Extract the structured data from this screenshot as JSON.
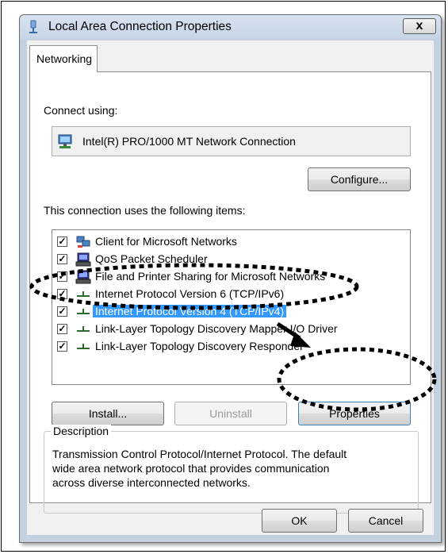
{
  "window": {
    "title": "Local Area Connection Properties",
    "close_label": "x"
  },
  "tabs": [
    {
      "label": "Networking"
    }
  ],
  "connect_using": {
    "label": "Connect using:",
    "adapter": "Intel(R) PRO/1000 MT Network Connection",
    "configure_label": "Configure..."
  },
  "items_section": {
    "label": "This connection uses the following items:",
    "items": [
      {
        "label": "Client for Microsoft Networks",
        "checked": true,
        "icon": "network-client-icon"
      },
      {
        "label": "QoS Packet Scheduler",
        "checked": true,
        "icon": "service-icon"
      },
      {
        "label": "File and Printer Sharing for Microsoft Networks",
        "checked": true,
        "icon": "service-icon"
      },
      {
        "label": "Internet Protocol Version 6 (TCP/IPv6)",
        "checked": true,
        "icon": "protocol-icon"
      },
      {
        "label": "Internet Protocol Version 4 (TCP/IPv4)",
        "checked": true,
        "icon": "protocol-icon",
        "selected": true
      },
      {
        "label": "Link-Layer Topology Discovery Mapper I/O Driver",
        "checked": true,
        "icon": "protocol-icon"
      },
      {
        "label": "Link-Layer Topology Discovery Responder",
        "checked": true,
        "icon": "protocol-icon"
      }
    ]
  },
  "buttons": {
    "install": "Install...",
    "uninstall": "Uninstall",
    "properties": "Properties",
    "ok": "OK",
    "cancel": "Cancel"
  },
  "description": {
    "title": "Description",
    "lines": [
      "Transmission Control Protocol/Internet Protocol. The default",
      "wide area network protocol that provides communication",
      "across diverse interconnected networks."
    ]
  },
  "colors": {
    "selection": "#3399ff",
    "annotation": "#000000"
  }
}
